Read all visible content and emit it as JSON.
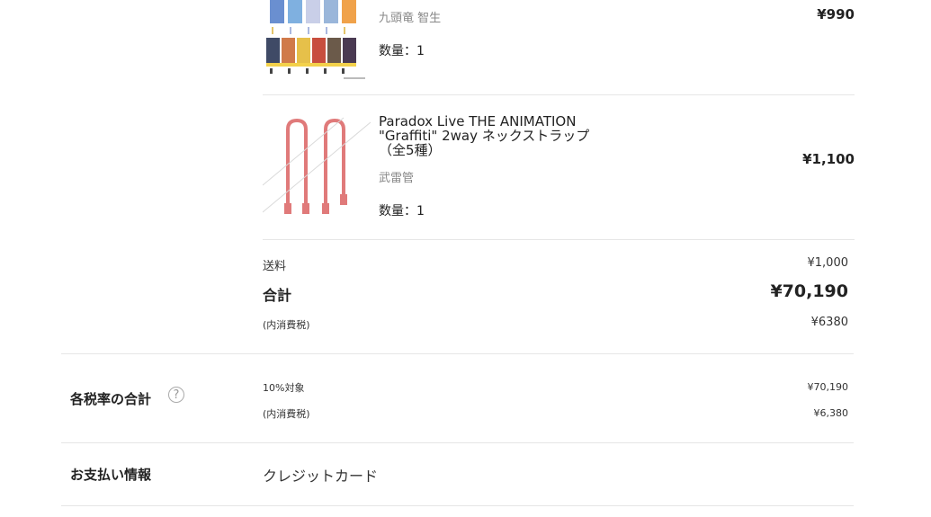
{
  "items": [
    {
      "variant": "九頭竜 智生",
      "quantity": "数量：1",
      "price": "¥990"
    },
    {
      "name_line1": "Paradox Live THE ANIMATION",
      "name_line2": "\"Graffiti\" 2way ネックストラップ",
      "name_line3": "（全5種）",
      "variant": "武雷管",
      "quantity": "数量：1",
      "price": "¥1,100"
    }
  ],
  "summary": {
    "shipping_label": "送料",
    "shipping_value": "¥1,000",
    "total_label": "合計",
    "total_value": "¥70,190",
    "tax_label": "(内消費税)",
    "tax_value": "¥6380"
  },
  "tax_rate": {
    "heading": "各税率の合計",
    "help_icon_glyph": "?",
    "target_label": "10%対象",
    "target_value": "¥70,190",
    "tax_label": "(内消費税)",
    "tax_value": "¥6,380"
  },
  "payment": {
    "heading": "お支払い情報",
    "method": "クレジットカード"
  },
  "colors": {
    "strap_red": "#e07a7a",
    "divider": "#e6e6e6"
  }
}
